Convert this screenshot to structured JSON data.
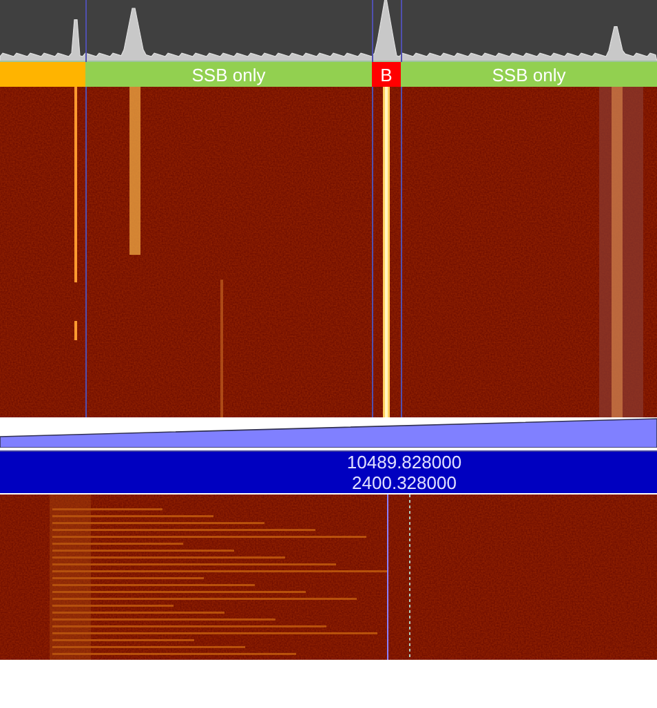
{
  "band_plan": [
    {
      "color": "#ffb400"
    },
    {
      "label": "SSB only",
      "color": "#92d050"
    },
    {
      "label": "B",
      "color": "#ff0000"
    },
    {
      "label": "SSB only",
      "color": "#92d050"
    }
  ],
  "frequency_display": {
    "line_1": "10489.828000",
    "line_2": "2400.328000"
  }
}
